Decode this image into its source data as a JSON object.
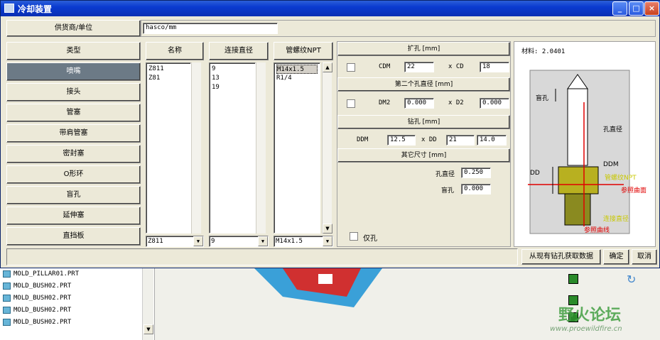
{
  "window": {
    "title": "冷却装置",
    "min": "_",
    "max": "□",
    "close": "×"
  },
  "supplier": {
    "label": "供货商/单位",
    "value": "hasco/mm"
  },
  "categories": [
    {
      "label": "类型"
    },
    {
      "label": "喷嘴"
    },
    {
      "label": "接头"
    },
    {
      "label": "管塞"
    },
    {
      "label": "带肩管塞"
    },
    {
      "label": "密封塞"
    },
    {
      "label": "O形环"
    },
    {
      "label": "盲孔"
    },
    {
      "label": "延伸塞"
    },
    {
      "label": "直挡板"
    }
  ],
  "columns": {
    "name": {
      "header": "名称",
      "items": [
        "Z811",
        "Z81"
      ],
      "selected": "Z811"
    },
    "connect": {
      "header": "连接直径",
      "items": [
        "9",
        "13",
        "19"
      ],
      "selected": "9"
    },
    "thread": {
      "header": "管螺纹NPT",
      "items": [
        "M14x1.5",
        "R1/4"
      ],
      "selected": "M14x1.5"
    }
  },
  "params": {
    "counterbore_header": "扩孔 [mm]",
    "cdm_label": "CDM",
    "cdm_value": "22",
    "xcd_label": "x CD",
    "cd_value": "18",
    "second_header": "第二个孔直径 [mm]",
    "dm2_label": "DM2",
    "dm2_value": "0.000",
    "xd2_label": "x D2",
    "d2_value": "0.000",
    "drill_header": "钻孔 [mm]",
    "ddm_label": "DDM",
    "ddm_value": "12.5",
    "xdd_label": "x DD",
    "dd_value": "21",
    "dd2_value": "14.0",
    "other_header": "其它尺寸 [mm]",
    "hole_dia_label": "孔直径",
    "hole_dia_value": "0.250",
    "blind_label": "盲孔",
    "blind_value": "0.000",
    "hole_only_label": "仅孔"
  },
  "preview": {
    "material_label": "材料: 2.0401",
    "labels": {
      "blind": "盲孔",
      "hole_dia": "孔直径",
      "ddm": "DDM",
      "dd": "DD",
      "thread": "管螺纹NPT",
      "ref_plane": "参照曲面",
      "connect": "连接直径",
      "ref_curve": "参照曲线"
    }
  },
  "buttons": {
    "fetch": "从现有钻孔获取数据",
    "ok": "确定",
    "cancel": "取消"
  },
  "tree": [
    "MOLD_PILLAR01.PRT",
    "MOLD_BUSH02.PRT",
    "MOLD_BUSH02.PRT",
    "MOLD_BUSH02.PRT",
    "MOLD_BUSH02.PRT"
  ],
  "watermark": {
    "text": "野火论坛",
    "url": "www.proewildfire.cn"
  }
}
